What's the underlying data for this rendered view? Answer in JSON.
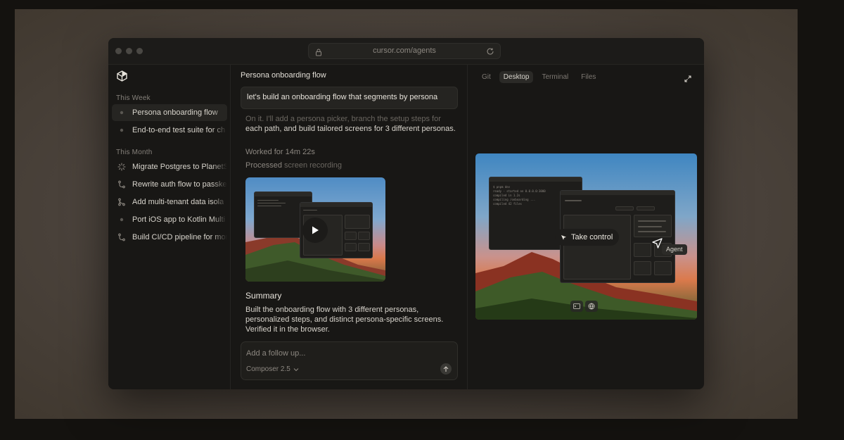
{
  "browser": {
    "url": "cursor.com/agents"
  },
  "sidebar": {
    "sections": [
      {
        "label": "This Week",
        "items": [
          {
            "label": "Persona onboarding flow",
            "active": true,
            "icon": "dot-icon"
          },
          {
            "label": "End-to-end test suite for ch",
            "active": false,
            "icon": "dot-icon"
          }
        ]
      },
      {
        "label": "This Month",
        "items": [
          {
            "label": "Migrate Postgres to PlanetS",
            "icon": "spinner-icon"
          },
          {
            "label": "Rewrite auth flow to passke",
            "icon": "branch-icon"
          },
          {
            "label": "Add multi-tenant data isola",
            "icon": "merge-icon"
          },
          {
            "label": "Port iOS app to Kotlin Multi",
            "icon": "dot-icon"
          },
          {
            "label": "Build CI/CD pipeline for mor",
            "icon": "branch-icon"
          }
        ]
      }
    ]
  },
  "chat": {
    "title": "Persona onboarding flow",
    "user_message": "let's build an onboarding flow that segments by persona",
    "reply_dim": "On it. I'll add a persona picker, branch the setup steps for",
    "reply_rest": "each path, and build tailored screens for 3 different personas.",
    "worked_for": "Worked for 14m 22s",
    "processed_label": "Processed",
    "processed_link": "screen recording",
    "summary_title": "Summary",
    "summary_text": "Built the onboarding flow with 3 different personas, personalized steps, and distinct persona-specific screens. Verified it in the browser.",
    "followup_placeholder": "Add a follow up...",
    "model": "Composer 2.5"
  },
  "preview": {
    "tabs": [
      {
        "label": "Git",
        "active": false
      },
      {
        "label": "Desktop",
        "active": true
      },
      {
        "label": "Terminal",
        "active": false
      },
      {
        "label": "Files",
        "active": false
      }
    ],
    "take_control": "Take control",
    "agent_tag": "Agent",
    "terminal_lines": [
      "$ pnpm dev",
      "ready - started on 0.0.0.0:3000",
      "compiled in 1.2s",
      "compiling /onboarding ...",
      "compiled 42 files"
    ]
  }
}
